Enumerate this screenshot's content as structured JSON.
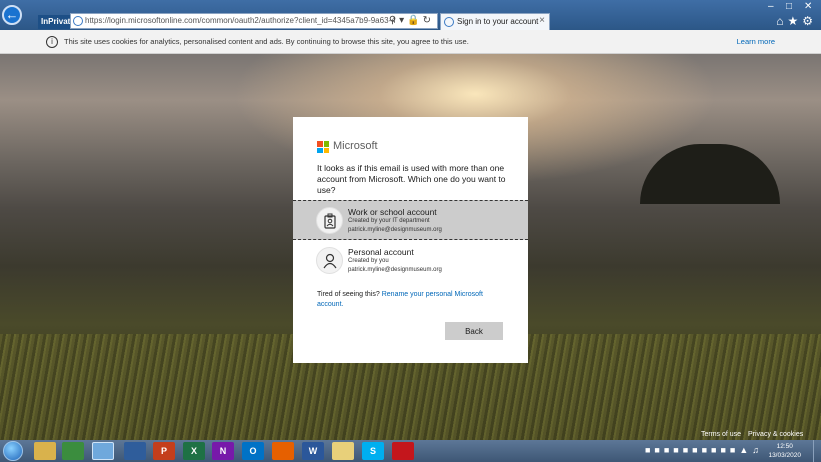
{
  "browser": {
    "mode_badge": "InPrivate",
    "url": "https://login.microsoftonline.com/common/oauth2/authorize?client_id=4345a7b9-9a63-4910-a426-35363201",
    "tab_title": "Sign in to your account"
  },
  "cookie_bar": {
    "message": "This site uses cookies for analytics, personalised content and ads. By continuing to browse this site, you agree to this use.",
    "learn_more": "Learn more"
  },
  "dialog": {
    "brand": "Microsoft",
    "prompt": "It looks as if this email is used with more than one account from Microsoft. Which one do you want to use?",
    "accounts": [
      {
        "title": "Work or school account",
        "subtitle": "Created by your IT department",
        "email": "patrick.myline@designmuseum.org",
        "icon": "badge-icon"
      },
      {
        "title": "Personal account",
        "subtitle": "Created by you",
        "email": "patrick.myline@designmuseum.org",
        "icon": "person-icon"
      }
    ],
    "tired_text": "Tired of seeing this?",
    "rename_link": "Rename your personal Microsoft account.",
    "back_button": "Back"
  },
  "footer": {
    "terms": "Terms of use",
    "privacy": "Privacy & cookies"
  },
  "taskbar": {
    "time": "12:50",
    "date": "13/03/2020"
  },
  "colors": {
    "accent_link": "#0067b8",
    "selected_row": "#cccccc",
    "ms_red": "#f25022",
    "ms_green": "#7fba00",
    "ms_blue": "#00a4ef",
    "ms_yellow": "#ffb900"
  }
}
